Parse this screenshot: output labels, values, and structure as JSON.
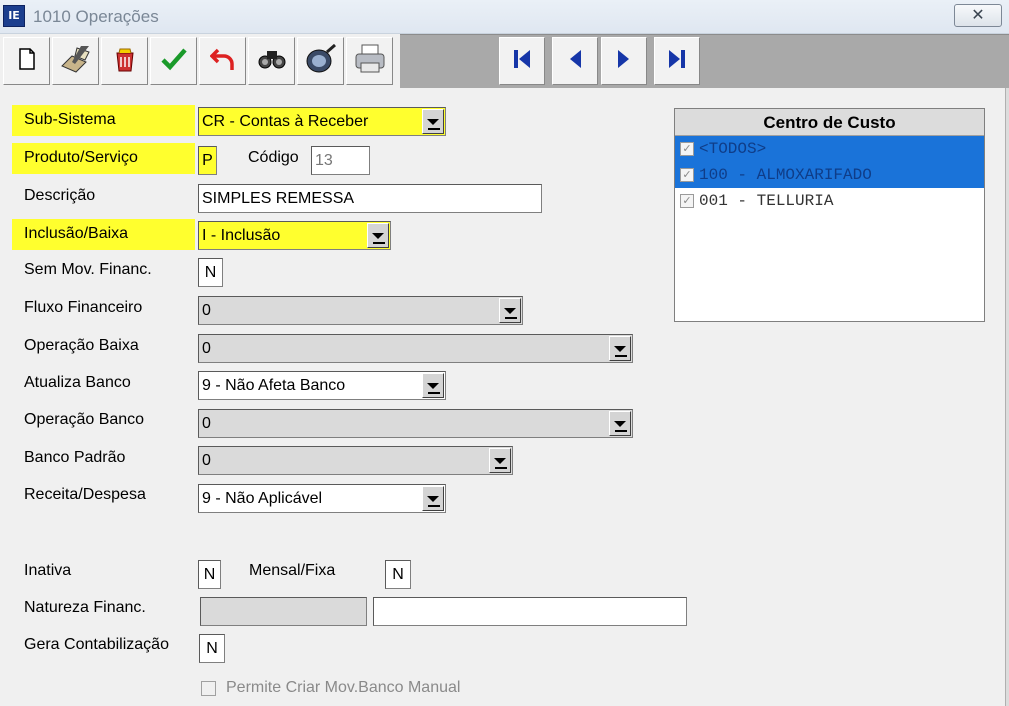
{
  "window": {
    "title": "1010 Operações",
    "close_glyph": "✕",
    "icon_text": "IE"
  },
  "toolbar": {
    "buttons": [
      {
        "name": "new-icon"
      },
      {
        "name": "edit-icon"
      },
      {
        "name": "delete-icon"
      },
      {
        "name": "confirm-icon"
      },
      {
        "name": "undo-icon"
      },
      {
        "name": "search-icon"
      },
      {
        "name": "filter-icon"
      },
      {
        "name": "print-icon"
      }
    ],
    "nav": [
      {
        "name": "first-record-icon"
      },
      {
        "name": "previous-record-icon"
      },
      {
        "name": "next-record-icon"
      },
      {
        "name": "last-record-icon"
      }
    ]
  },
  "form": {
    "sub_sistema": {
      "label": "Sub-Sistema",
      "value": "CR - Contas à Receber"
    },
    "produto_servico": {
      "label": "Produto/Serviço",
      "value": "P"
    },
    "codigo": {
      "label": "Código",
      "value": "13"
    },
    "descricao": {
      "label": "Descrição",
      "value": "SIMPLES REMESSA"
    },
    "inclusao_baixa": {
      "label": "Inclusão/Baixa",
      "value": "I - Inclusão"
    },
    "sem_mov": {
      "label": "Sem Mov. Financ.",
      "value": "N"
    },
    "fluxo": {
      "label": "Fluxo Financeiro",
      "value": "0"
    },
    "operacao_baixa": {
      "label": "Operação Baixa",
      "value": "0"
    },
    "atualiza_banco": {
      "label": "Atualiza Banco",
      "value": "9 - Não Afeta Banco"
    },
    "operacao_banco": {
      "label": "Operação Banco",
      "value": "0"
    },
    "banco_padrao": {
      "label": "Banco Padrão",
      "value": "0"
    },
    "receita_despesa": {
      "label": "Receita/Despesa",
      "value": "9 - Não Aplicável"
    },
    "inativa": {
      "label": "Inativa",
      "value": "N"
    },
    "mensal_fixa": {
      "label": "Mensal/Fixa",
      "value": "N"
    },
    "natureza": {
      "label": "Natureza Financ.",
      "code": "",
      "description": ""
    },
    "gera_contab": {
      "label": "Gera Contabilização",
      "value": "N"
    },
    "permite": {
      "label": "Permite Criar Mov.Banco Manual",
      "checked": false
    }
  },
  "centro_custo": {
    "title": "Centro de Custo",
    "items": [
      {
        "label": "<TODOS>",
        "checked": true,
        "selected": true
      },
      {
        "label": "100 - ALMOXARIFADO",
        "checked": true,
        "selected": true
      },
      {
        "label": "001 - TELLURIA",
        "checked": true,
        "selected": false
      }
    ]
  },
  "colors": {
    "highlight": "#ffff2e",
    "selection": "#1a73d9",
    "toolbar_bg": "#a9a9a9"
  }
}
